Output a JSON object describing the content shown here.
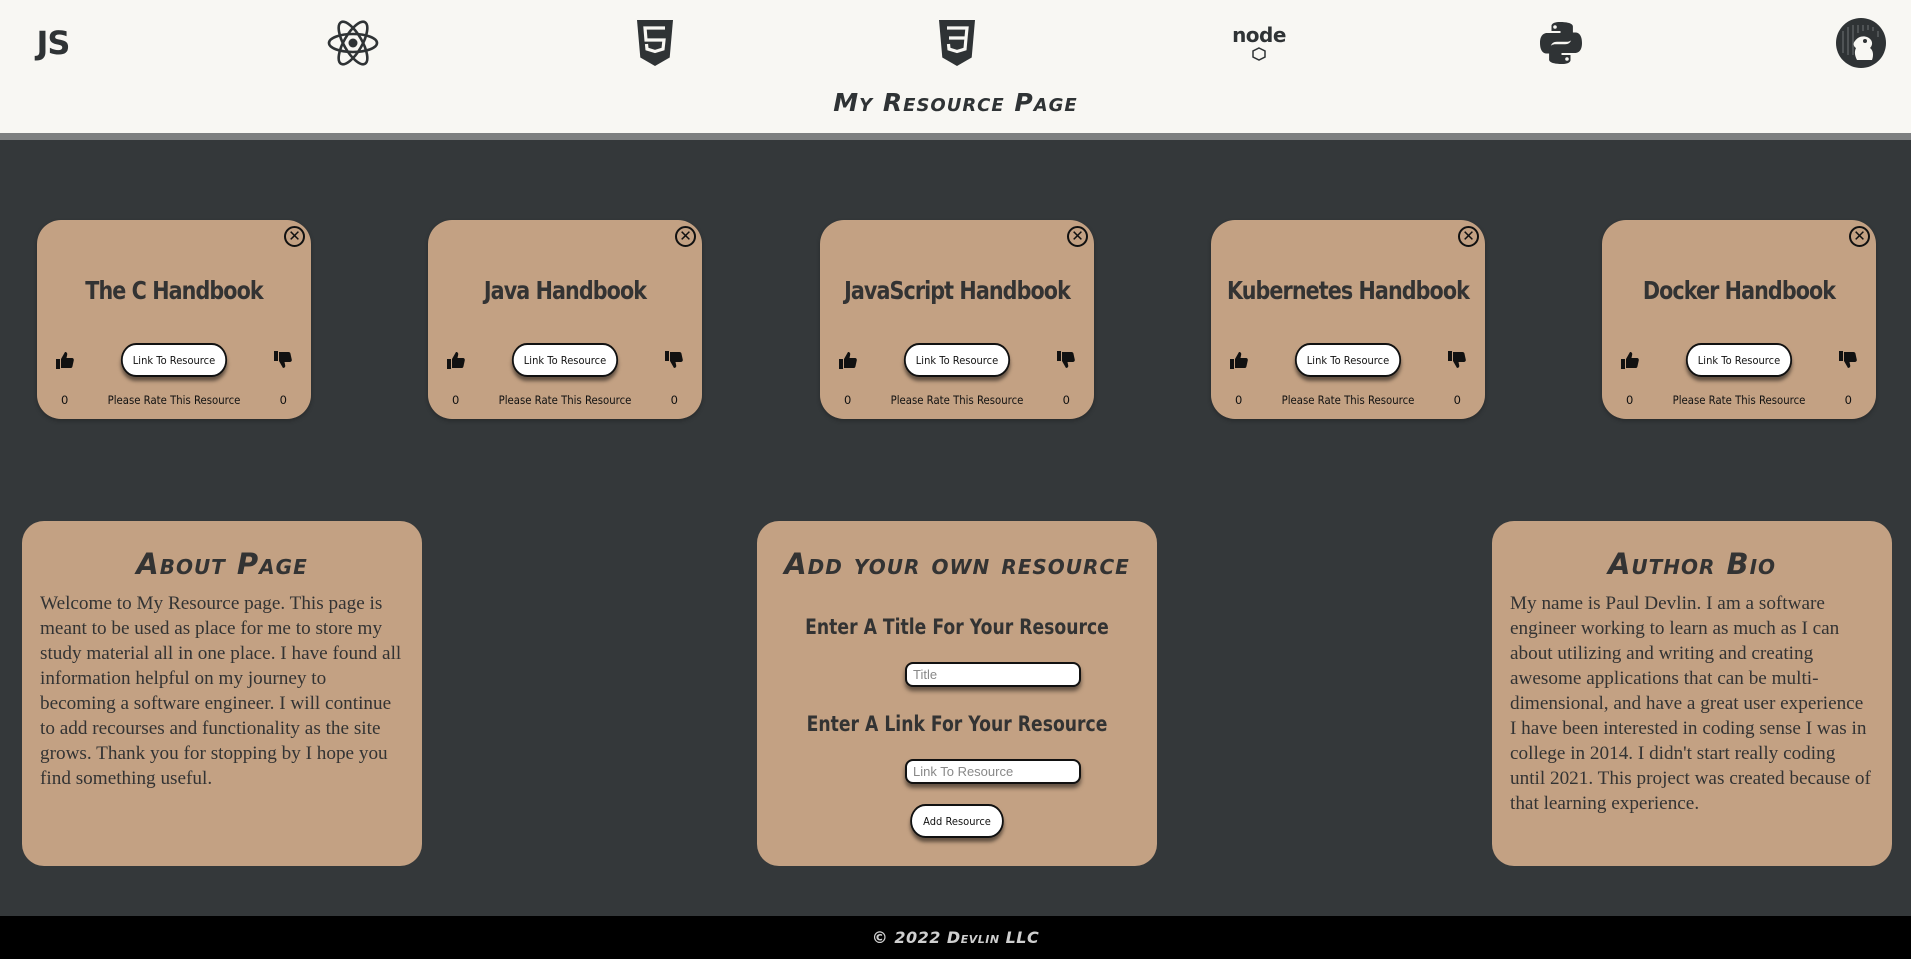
{
  "header": {
    "title": "My Resource Page",
    "logos": [
      "javascript-logo",
      "react-logo",
      "html5-logo",
      "css3-logo",
      "nodejs-logo",
      "python-logo",
      "docker-logo"
    ],
    "js_text": "JS",
    "node_text": "node"
  },
  "cards": [
    {
      "title": "The C Handbook",
      "link_label": "Link To Resource",
      "rate_text": "Please Rate This Resource",
      "likes": "0",
      "dislikes": "0",
      "close": "✕"
    },
    {
      "title": "Java Handbook",
      "link_label": "Link To Resource",
      "rate_text": "Please Rate This Resource",
      "likes": "0",
      "dislikes": "0",
      "close": "✕"
    },
    {
      "title": "JavaScript Handbook",
      "link_label": "Link To Resource",
      "rate_text": "Please Rate This Resource",
      "likes": "0",
      "dislikes": "0",
      "close": "✕"
    },
    {
      "title": "Kubernetes Handbook",
      "link_label": "Link To Resource",
      "rate_text": "Please Rate This Resource",
      "likes": "0",
      "dislikes": "0",
      "close": "✕"
    },
    {
      "title": "Docker Handbook",
      "link_label": "Link To Resource",
      "rate_text": "Please Rate This Resource",
      "likes": "0",
      "dislikes": "0",
      "close": "✕"
    }
  ],
  "about": {
    "heading": "About Page",
    "text": "Welcome to My Resource page. This page is meant to be used as place for me to store my study material all in one place. I have found all information helpful on my journey to becoming a software engineer. I will continue to add recourses and functionality as the site grows. Thank you for stopping by I hope you find something useful."
  },
  "add_form": {
    "heading": "Add your own resource",
    "title_label": "Enter A Title For Your Resource",
    "title_placeholder": "Title",
    "link_label": "Enter A Link For Your Resource",
    "link_placeholder": "Link To Resource",
    "button_label": "Add Resource"
  },
  "bio": {
    "heading": "Author Bio",
    "text": "My name is Paul Devlin. I am a software engineer working to learn as much as I can about utilizing and writing and creating awesome applications that can be multi-dimensional, and have a great user experience I have been interested in coding sense I was in college in 2014. I didn't start really coding until 2021. This project was created because of that learning experience."
  },
  "footer": {
    "copyright": "© 2022 Devlin LLC"
  },
  "colors": {
    "page_bg": "#34383a",
    "header_bg": "#f8f7f3",
    "card_bg": "#c3a183",
    "text_dark": "#333333",
    "footer_bg": "#000000"
  }
}
